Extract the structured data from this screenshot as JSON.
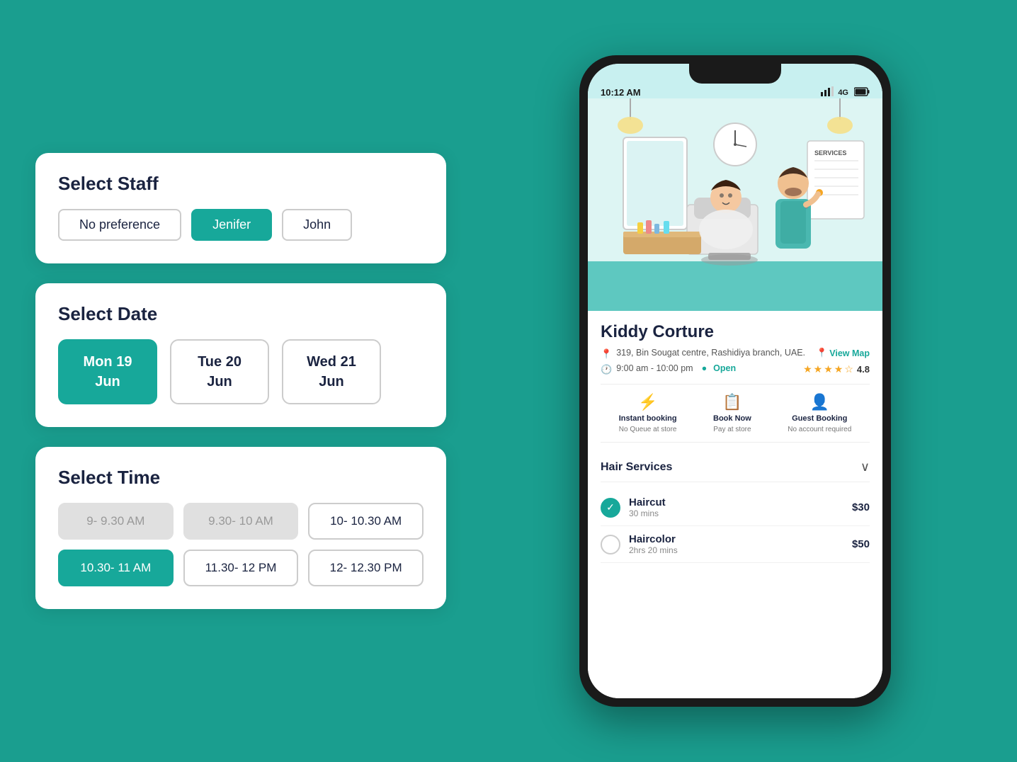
{
  "background_color": "#1a9e8f",
  "left": {
    "staff_section": {
      "title": "Select Staff",
      "buttons": [
        {
          "label": "No preference",
          "active": false
        },
        {
          "label": "Jenifer",
          "active": true
        },
        {
          "label": "John",
          "active": false
        }
      ]
    },
    "date_section": {
      "title": "Select Date",
      "buttons": [
        {
          "label": "Mon 19\nJun",
          "line1": "Mon 19",
          "line2": "Jun",
          "active": true
        },
        {
          "label": "Tue 20\nJun",
          "line1": "Tue 20",
          "line2": "Jun",
          "active": false
        },
        {
          "label": "Wed 21\nJun",
          "line1": "Wed 21",
          "line2": "Jun",
          "active": false
        }
      ]
    },
    "time_section": {
      "title": "Select Time",
      "buttons": [
        {
          "label": "9- 9.30 AM",
          "state": "disabled"
        },
        {
          "label": "9.30- 10 AM",
          "state": "disabled"
        },
        {
          "label": "10- 10.30 AM",
          "state": "normal"
        },
        {
          "label": "10.30- 11 AM",
          "state": "active"
        },
        {
          "label": "11.30- 12 PM",
          "state": "normal"
        },
        {
          "label": "12- 12.30 PM",
          "state": "normal"
        }
      ]
    }
  },
  "phone": {
    "status_bar": {
      "time": "10:12 AM",
      "signal": "4G",
      "battery": "██"
    },
    "shop": {
      "name": "Kiddy Corture",
      "address": "319, Bin Sougat centre, Rashidiya branch, UAE.",
      "hours": "9:00 am - 10:00 pm",
      "open_status": "Open",
      "rating": "4.8",
      "view_map_label": "View Map"
    },
    "features": [
      {
        "icon": "⚡",
        "label": "Instant booking",
        "sub": "No Queue at store"
      },
      {
        "icon": "🗓",
        "label": "Book Now",
        "sub": "Pay at store"
      },
      {
        "icon": "👤",
        "label": "Guest Booking",
        "sub": "No account required"
      }
    ],
    "services_section": {
      "title": "Hair Services",
      "chevron": "∨",
      "items": [
        {
          "name": "Haircut",
          "duration": "30 mins",
          "price": "$30",
          "checked": true
        },
        {
          "name": "Haircolor",
          "duration": "2hrs 20 mins",
          "price": "$50",
          "checked": false
        }
      ]
    }
  }
}
